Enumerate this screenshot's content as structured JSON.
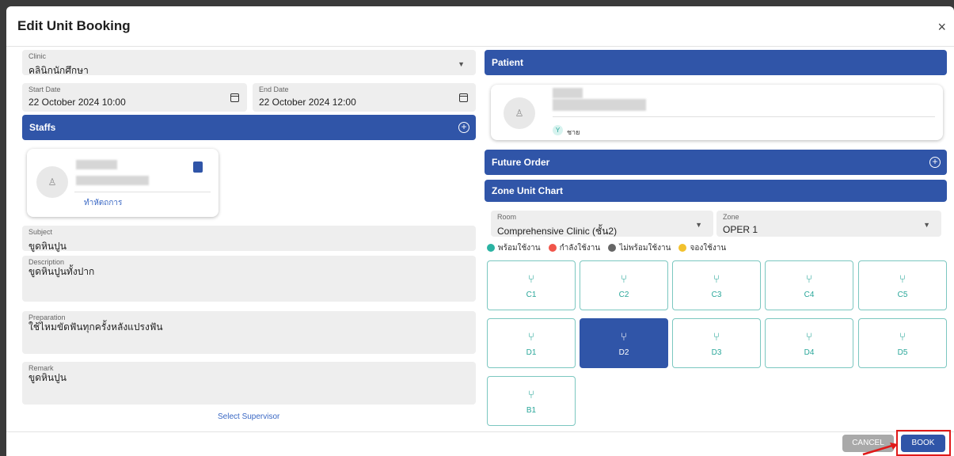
{
  "dialog": {
    "title": "Edit Unit Booking",
    "close_glyph": "×"
  },
  "clinic": {
    "label": "Clinic",
    "value": "คลินิกนักศึกษา"
  },
  "start_date": {
    "label": "Start Date",
    "value": "22 October 2024 10:00"
  },
  "end_date": {
    "label": "End Date",
    "value": "22 October 2024 12:00"
  },
  "staffs": {
    "title": "Staffs",
    "action_label": "ทำหัตถการ"
  },
  "subject": {
    "label": "Subject",
    "value": "ขูดหินปูน"
  },
  "description": {
    "label": "Description",
    "value": "ขูดหินปูนทั้งปาก"
  },
  "preparation": {
    "label": "Preparation",
    "value": "ใช้ไหมขัดฟันทุกครั้งหลังแปรงฟัน"
  },
  "remark": {
    "label": "Remark",
    "value": "ขูดหินปูน"
  },
  "supervisor_link": "Select Supervisor",
  "patient": {
    "title": "Patient",
    "gender_badge": "Y",
    "gender": "ชาย"
  },
  "future_order": {
    "title": "Future Order"
  },
  "zone_unit_chart": {
    "title": "Zone Unit Chart"
  },
  "room": {
    "label": "Room",
    "value": "Comprehensive Clinic (ชั้น2)"
  },
  "zone": {
    "label": "Zone",
    "value": "OPER 1"
  },
  "legend": [
    {
      "label": "พร้อมใช้งาน",
      "color": "#2bb3a3"
    },
    {
      "label": "กำลังใช้งาน",
      "color": "#f0554a"
    },
    {
      "label": "ไม่พร้อมใช้งาน",
      "color": "#666666"
    },
    {
      "label": "จองใช้งาน",
      "color": "#f2c12e"
    }
  ],
  "units": [
    {
      "name": "C1",
      "selected": false
    },
    {
      "name": "C2",
      "selected": false
    },
    {
      "name": "C3",
      "selected": false
    },
    {
      "name": "C4",
      "selected": false
    },
    {
      "name": "C5",
      "selected": false
    },
    {
      "name": "D1",
      "selected": false
    },
    {
      "name": "D2",
      "selected": true
    },
    {
      "name": "D3",
      "selected": false
    },
    {
      "name": "D4",
      "selected": false
    },
    {
      "name": "D5",
      "selected": false
    },
    {
      "name": "B1",
      "selected": false
    }
  ],
  "unit_icon": "dental-chair-icon",
  "buttons": {
    "cancel": "CANCEL",
    "book": "BOOK"
  },
  "colors": {
    "primary": "#3055a8",
    "unit_border": "#7bc7c0",
    "unit_text": "#2aa79a",
    "annotation": "#e01919"
  }
}
